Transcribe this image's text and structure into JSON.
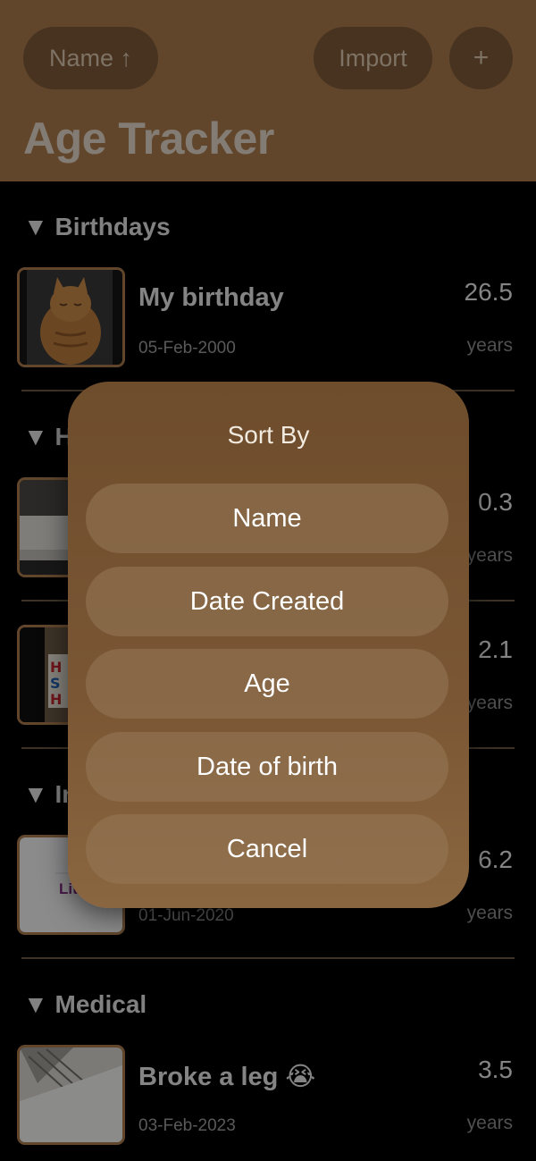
{
  "header": {
    "sort_label": "Name ↑",
    "import_label": "Import",
    "add_label": "+",
    "title": "Age Tracker"
  },
  "sections": [
    {
      "label": "▼ Birthdays",
      "rows": [
        {
          "name": "My birthday",
          "date": "05-Feb-2000",
          "age": "26.5",
          "unit": "years",
          "thumb_icon": "cat-photo"
        }
      ]
    },
    {
      "label": "▼ Ho",
      "rows": [
        {
          "name": "",
          "date": "",
          "age": "0.3",
          "unit": "years",
          "thumb_icon": "sofa-photo"
        },
        {
          "name": "",
          "date": "",
          "age": "2.1",
          "unit": "years",
          "thumb_icon": "poster-photo"
        }
      ]
    },
    {
      "label": "▼ In",
      "rows": [
        {
          "name": "",
          "date": "01-Jun-2020",
          "age": "6.2",
          "unit": "years",
          "thumb_icon": "document-photo",
          "thumb_text": "Lit"
        }
      ]
    },
    {
      "label": "▼ Medical",
      "rows": [
        {
          "name": "Broke a leg 😭",
          "date": "03-Feb-2023",
          "age": "3.5",
          "unit": "years",
          "thumb_icon": "cast-photo"
        }
      ]
    }
  ],
  "dialog": {
    "title": "Sort By",
    "options": [
      "Name",
      "Date Created",
      "Age",
      "Date of birth",
      "Cancel"
    ]
  },
  "colors": {
    "accent": "#a8794c",
    "button": "#7a5936",
    "background": "#000000"
  }
}
